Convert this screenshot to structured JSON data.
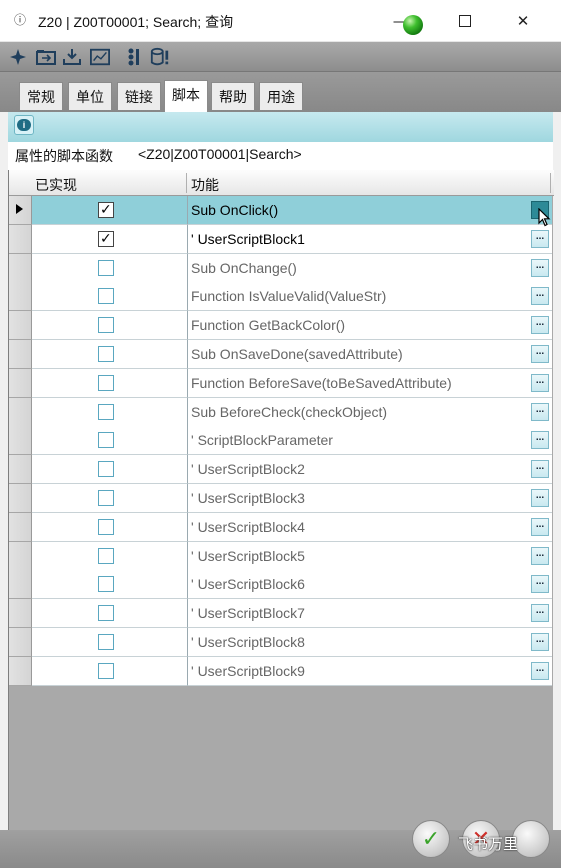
{
  "window": {
    "info_glyph": "ⓘ",
    "title": "Z20 | Z00T00001; Search; 查询",
    "controls": {
      "minimize": "—",
      "maximize": "□",
      "close": "✕"
    }
  },
  "toolbar": {
    "icons": [
      "sparkle-icon",
      "folder-open-icon",
      "import-icon",
      "chart-icon",
      "list-icon",
      "database-icon"
    ]
  },
  "tabs": [
    {
      "label": "常规",
      "active": false
    },
    {
      "label": "单位",
      "active": false
    },
    {
      "label": "链接",
      "active": false
    },
    {
      "label": "脚本",
      "active": true
    },
    {
      "label": "帮助",
      "active": false
    },
    {
      "label": "用途",
      "active": false
    }
  ],
  "properties": {
    "label": "属性的脚本函数",
    "value": "<Z20|Z00T00001|Search>"
  },
  "grid": {
    "columns": [
      "已实现",
      "功能"
    ],
    "ellipsis": "...",
    "rows": [
      {
        "implemented": true,
        "name": "Sub OnClick()",
        "selected": true
      },
      {
        "implemented": true,
        "name": "' UserScriptBlock1",
        "selected": false
      },
      {
        "implemented": false,
        "name": "Sub OnChange()",
        "selected": false
      },
      {
        "implemented": false,
        "name": "Function IsValueValid(ValueStr)",
        "selected": false
      },
      {
        "implemented": false,
        "name": "Function GetBackColor()",
        "selected": false
      },
      {
        "implemented": false,
        "name": "Sub OnSaveDone(savedAttribute)",
        "selected": false
      },
      {
        "implemented": false,
        "name": "Function BeforeSave(toBeSavedAttribute)",
        "selected": false
      },
      {
        "implemented": false,
        "name": "Sub BeforeCheck(checkObject)",
        "selected": false
      },
      {
        "implemented": false,
        "name": "' ScriptBlockParameter",
        "selected": false
      },
      {
        "implemented": false,
        "name": "' UserScriptBlock2",
        "selected": false
      },
      {
        "implemented": false,
        "name": "' UserScriptBlock3",
        "selected": false
      },
      {
        "implemented": false,
        "name": "' UserScriptBlock4",
        "selected": false
      },
      {
        "implemented": false,
        "name": "' UserScriptBlock5",
        "selected": false
      },
      {
        "implemented": false,
        "name": "' UserScriptBlock6",
        "selected": false
      },
      {
        "implemented": false,
        "name": "' UserScriptBlock7",
        "selected": false
      },
      {
        "implemented": false,
        "name": "' UserScriptBlock8",
        "selected": false
      },
      {
        "implemented": false,
        "name": "' UserScriptBlock9",
        "selected": false
      }
    ]
  },
  "footer": {
    "ok_glyph": "✓",
    "cancel_glyph": "✕",
    "watermark": "飞书万里"
  }
}
